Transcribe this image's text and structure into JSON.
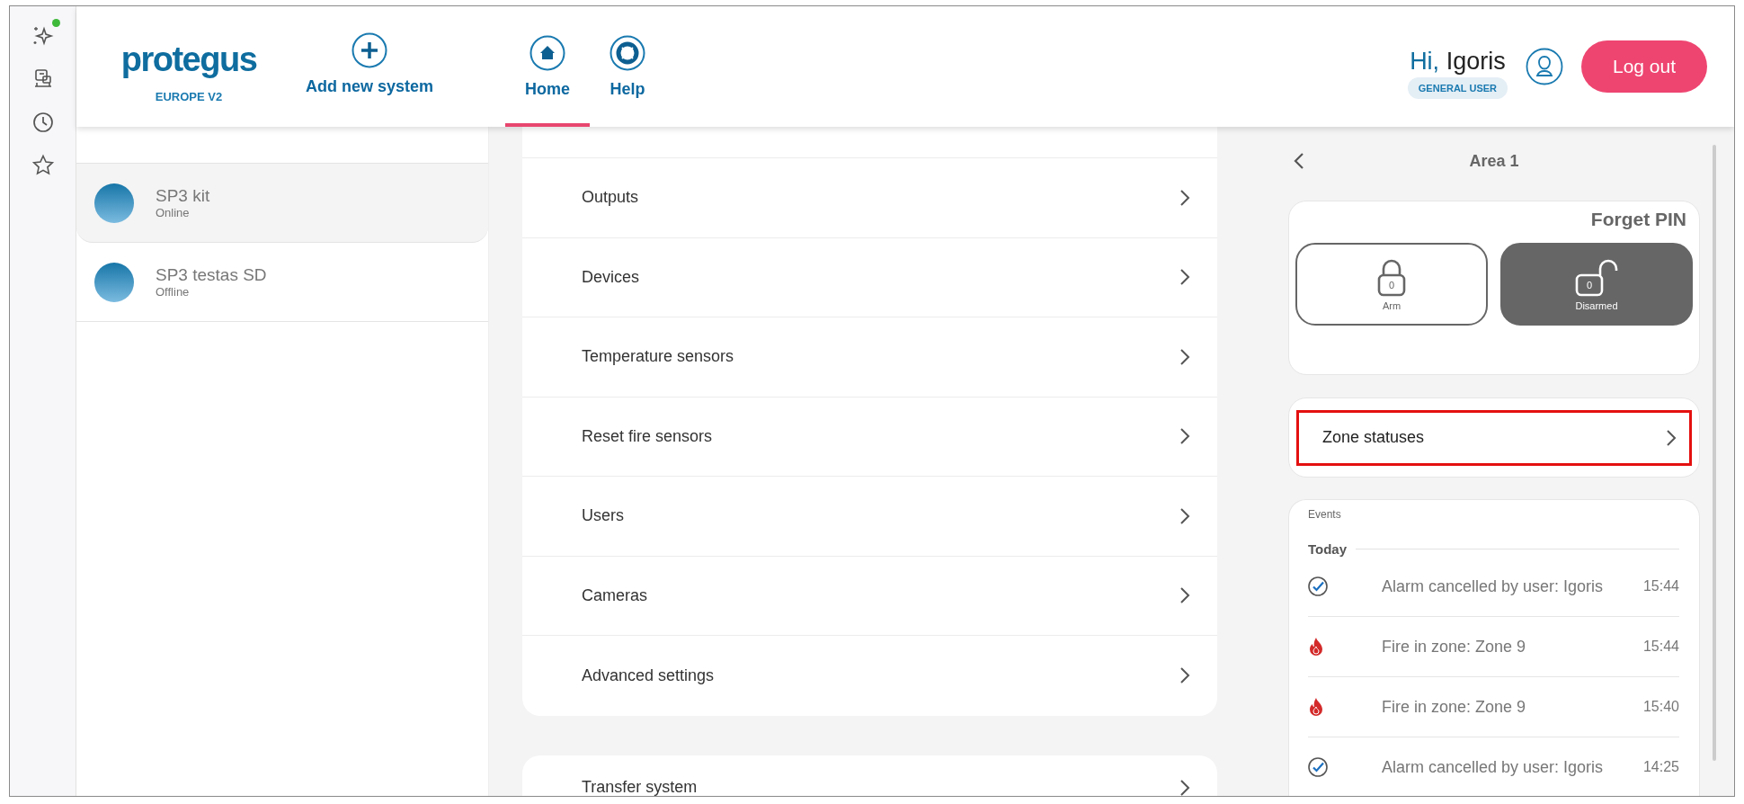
{
  "rail": [
    {
      "kind": "sparkle",
      "badge": true
    },
    {
      "kind": "device",
      "badge": false
    },
    {
      "kind": "clock",
      "badge": false
    },
    {
      "kind": "star",
      "badge": false
    }
  ],
  "header": {
    "logo": "protegus",
    "region": "EUROPE V2",
    "add_system": "Add new system",
    "nav": [
      {
        "label": "Home",
        "kind": "home",
        "selected": true
      },
      {
        "label": "Help",
        "kind": "help",
        "selected": false
      }
    ],
    "greeting": "Hi,",
    "user_name": "Igoris",
    "role": "GENERAL USER",
    "logout": "Log out"
  },
  "systems": [
    {
      "name": "SP3 kit",
      "status": "Online",
      "selected": true
    },
    {
      "name": "SP3 testas SD",
      "status": "Offline",
      "selected": false
    }
  ],
  "menu": [
    "Outputs",
    "Devices",
    "Temperature sensors",
    "Reset fire sensors",
    "Users",
    "Cameras",
    "Advanced settings"
  ],
  "menu_2": [
    "Transfer system"
  ],
  "area": {
    "title": "Area 1",
    "forget_pin": "Forget PIN",
    "modes": [
      {
        "label": "Arm",
        "kind": "locked",
        "pin": "0",
        "selected": false
      },
      {
        "label": "Disarmed",
        "kind": "unlocked",
        "pin": "0",
        "selected": true
      }
    ],
    "zone_statuses": {
      "label": "Zone statuses",
      "highlighted": true
    },
    "events": {
      "title": "Events",
      "day": "Today",
      "items": [
        {
          "kind": "ok",
          "text": "Alarm cancelled by user: Igoris",
          "time": "15:44"
        },
        {
          "kind": "fire",
          "text": "Fire in zone: Zone 9",
          "time": "15:44"
        },
        {
          "kind": "fire",
          "text": "Fire in zone: Zone 9",
          "time": "15:40"
        },
        {
          "kind": "ok",
          "text": "Alarm cancelled by user: Igoris",
          "time": "14:25"
        }
      ]
    }
  }
}
